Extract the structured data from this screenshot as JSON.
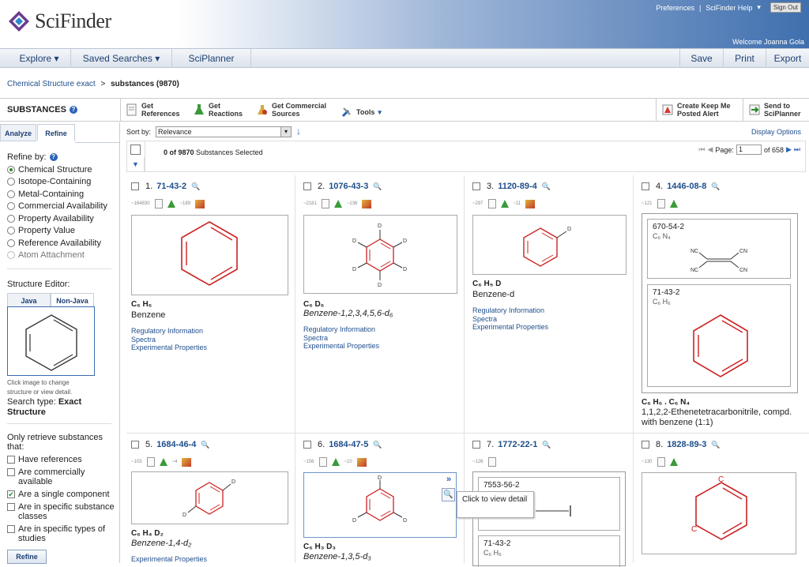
{
  "header": {
    "logo_text": "SciFinder",
    "preferences": "Preferences",
    "help": "SciFinder Help",
    "sign_out": "Sign Out",
    "welcome": "Welcome Joanna Gola"
  },
  "nav": {
    "explore": "Explore",
    "saved_searches": "Saved Searches",
    "sciplanner": "SciPlanner",
    "save": "Save",
    "print": "Print",
    "export": "Export"
  },
  "breadcrumb": {
    "link": "Chemical Structure exact",
    "sep": ">",
    "current": "substances (9870)"
  },
  "toolbar": {
    "section_title": "SUBSTANCES",
    "get_references": [
      "Get",
      "References"
    ],
    "get_reactions": [
      "Get",
      "Reactions"
    ],
    "get_commercial": [
      "Get Commercial",
      "Sources"
    ],
    "tools": "Tools",
    "keep_me_posted": [
      "Create Keep Me",
      "Posted Alert"
    ],
    "send_to_sciplanner": [
      "Send to",
      "SciPlanner"
    ]
  },
  "left": {
    "tab_analyze": "Analyze",
    "tab_refine": "Refine",
    "refine_by": "Refine by:",
    "options": [
      "Chemical Structure",
      "Isotope-Containing",
      "Metal-Containing",
      "Commercial Availability",
      "Property Availability",
      "Property Value",
      "Reference Availability",
      "Atom Attachment"
    ],
    "structure_editor": "Structure Editor:",
    "tab_java": "Java",
    "tab_nonjava": "Non-Java",
    "click_hint": "Click image to change structure or view detail.",
    "search_type_label": "Search type: ",
    "search_type_value": "Exact Structure",
    "only_retrieve": "Only retrieve substances that:",
    "filters": [
      {
        "label": "Have references",
        "checked": false
      },
      {
        "label": "Are commercially available",
        "checked": false
      },
      {
        "label": "Are a single component",
        "checked": true
      },
      {
        "label": "Are in specific substance classes",
        "checked": false
      },
      {
        "label": "Are in specific types of studies",
        "checked": false
      }
    ],
    "refine_button": "Refine"
  },
  "results": {
    "sort_label": "Sort by:",
    "sort_value": "Relevance",
    "display_options": "Display Options",
    "selected": "0 of 9870",
    "selected_suffix": "Substances Selected",
    "page_label": "Page:",
    "page_value": "1",
    "page_of": "of 658",
    "tooltip": "Click to view detail",
    "cards": [
      {
        "num": "1.",
        "cas": "71-43-2",
        "refs": "~164830",
        "reag": "~189",
        "formula": "C₆ H₆",
        "name": "Benzene",
        "links": [
          "Regulatory Information",
          "Spectra",
          "Experimental Properties"
        ]
      },
      {
        "num": "2.",
        "cas": "1076-43-3",
        "refs": "~2181",
        "reag": "~136",
        "formula": "C₆ D₆",
        "name": "Benzene-1,2,3,4,5,6-d₆",
        "links": [
          "Regulatory Information",
          "Spectra",
          "Experimental Properties"
        ]
      },
      {
        "num": "3.",
        "cas": "1120-89-4",
        "refs": "~297",
        "reag": "~11",
        "formula": "C₆ H₅ D",
        "name": "Benzene-d",
        "links": [
          "Regulatory Information",
          "Spectra",
          "Experimental Properties"
        ]
      },
      {
        "num": "4.",
        "cas": "1446-08-8",
        "refs": "~121",
        "reag": "",
        "formula": "C₆ H₆ . C₆ N₄",
        "name": "1,1,2,2-Ethenetetracarbonitrile, compd. with benzene (1:1)",
        "comp1_cas": "670-54-2",
        "comp1_formula": "C₆ N₄",
        "comp2_cas": "71-43-2",
        "comp2_formula": "C₆ H₆",
        "links": []
      },
      {
        "num": "5.",
        "cas": "1684-46-4",
        "refs": "~103",
        "reag": "~4",
        "formula": "C₆ H₄ D₂",
        "name": "Benzene-1,4-d₂",
        "links": [
          "Experimental Properties"
        ]
      },
      {
        "num": "6.",
        "cas": "1684-47-5",
        "refs": "~156",
        "reag": "~10",
        "formula": "C₆ H₃ D₃",
        "name": "Benzene-1,3,5-d₃",
        "links": []
      },
      {
        "num": "7.",
        "cas": "1772-22-1",
        "refs": "~126",
        "reag": "",
        "formula": "",
        "name": "",
        "comp1_cas": "7553-56-2",
        "comp1_formula": "",
        "comp2_cas": "71-43-2",
        "comp2_formula": "C₆ H₆",
        "links": []
      },
      {
        "num": "8.",
        "cas": "1828-89-3",
        "refs": "~130",
        "reag": "",
        "formula": "",
        "name": "",
        "links": []
      }
    ]
  },
  "colors": {
    "brand_blue": "#3f6fae",
    "link": "#1f4e8c",
    "molecule": "#cc2222"
  }
}
